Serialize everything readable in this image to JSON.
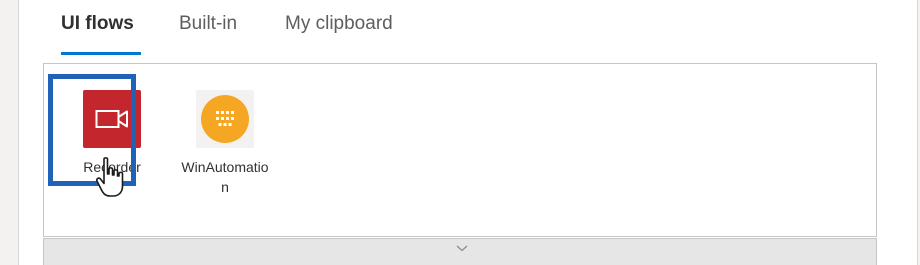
{
  "tabs": [
    {
      "label": "UI flows",
      "active": true
    },
    {
      "label": "Built-in",
      "active": false
    },
    {
      "label": "My clipboard",
      "active": false
    }
  ],
  "gallery": {
    "items": [
      {
        "label": "Recorder",
        "icon": "video-camera-icon",
        "color": "#c4262e",
        "selected": true
      },
      {
        "label": "WinAutomation",
        "icon": "winautomation-icon",
        "color": "#f5a623",
        "selected": false
      }
    ]
  },
  "expander": {
    "icon": "chevron-down-icon"
  },
  "colors": {
    "accent": "#0078d4",
    "selection": "#1f63b8"
  }
}
